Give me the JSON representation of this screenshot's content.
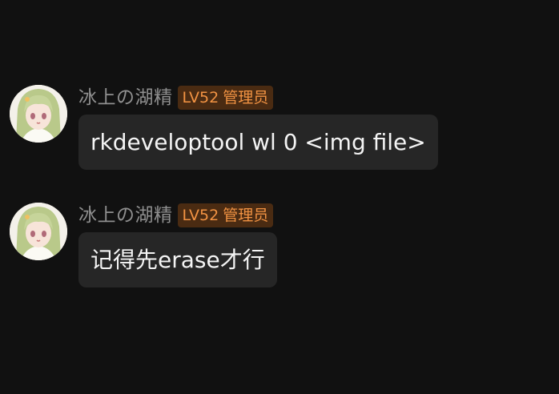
{
  "messages": [
    {
      "sender": "冰上の湖精",
      "badge": {
        "level": "LV52",
        "role": "管理员"
      },
      "text": "rkdeveloptool wl 0 <img file>"
    },
    {
      "sender": "冰上の湖精",
      "badge": {
        "level": "LV52",
        "role": "管理员"
      },
      "text": "记得先erase才行"
    }
  ],
  "colors": {
    "background": "#111111",
    "bubble": "#262626",
    "name": "#8f8f8f",
    "badge_bg": "#4a2b12",
    "badge_text": "#f29343"
  }
}
